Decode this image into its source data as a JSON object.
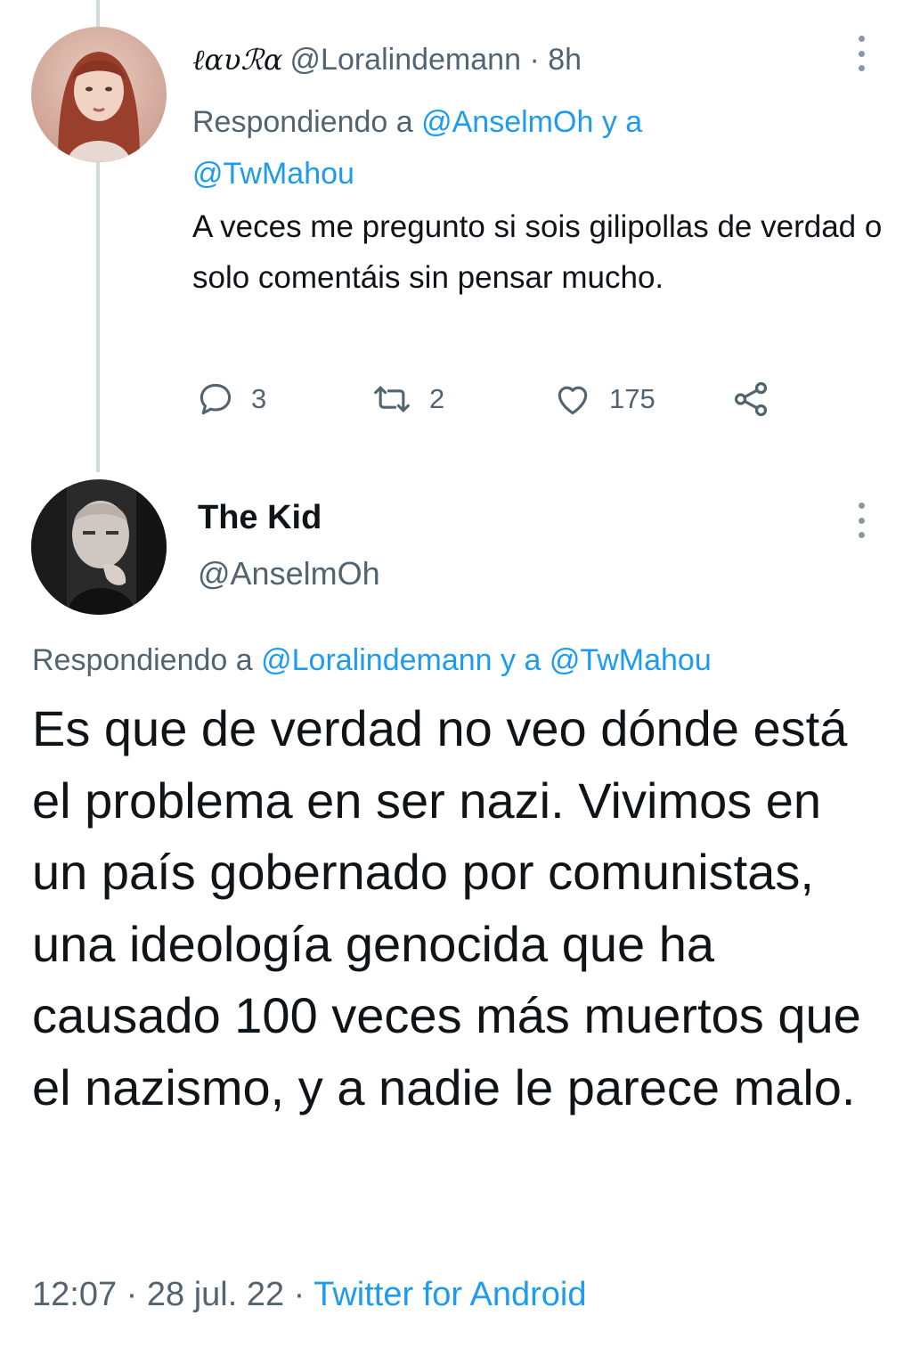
{
  "tweet1": {
    "display_name": "ℓαυℛα",
    "handle": "@Loralindemann",
    "separator": "·",
    "time": "8h",
    "replying_prefix": "Respondiendo a",
    "replying_to_1": "@AnselmOh",
    "replying_join": "y a",
    "replying_to_2": "@TwMahou",
    "text": "A veces me pregunto si sois gilipollas de verdad o solo comentáis sin pensar mucho.",
    "replies": "3",
    "retweets": "2",
    "likes": "175"
  },
  "tweet2": {
    "display_name": "The Kid",
    "handle": "@AnselmOh",
    "replying_prefix": "Respondiendo a",
    "replying_to_1": "@Loralindemann",
    "replying_join": "y a",
    "replying_to_2": "@TwMahou",
    "text": "Es que de verdad no veo dónde está el problema en ser nazi. Vivimos en un país gobernado por comunistas, una ideología genocida que ha causado 100 veces más muertos que el nazismo, y a nadie le parece malo.",
    "time": "12:07",
    "separator": "·",
    "date": "28 jul. 22",
    "source": "Twitter for Android"
  },
  "colors": {
    "text_primary": "#0f1419",
    "text_secondary": "#536471",
    "link": "#1d9bf0",
    "thread_line": "#cfd9de"
  },
  "icons": [
    "reply-icon",
    "retweet-icon",
    "like-icon",
    "share-icon",
    "more-options-icon"
  ]
}
